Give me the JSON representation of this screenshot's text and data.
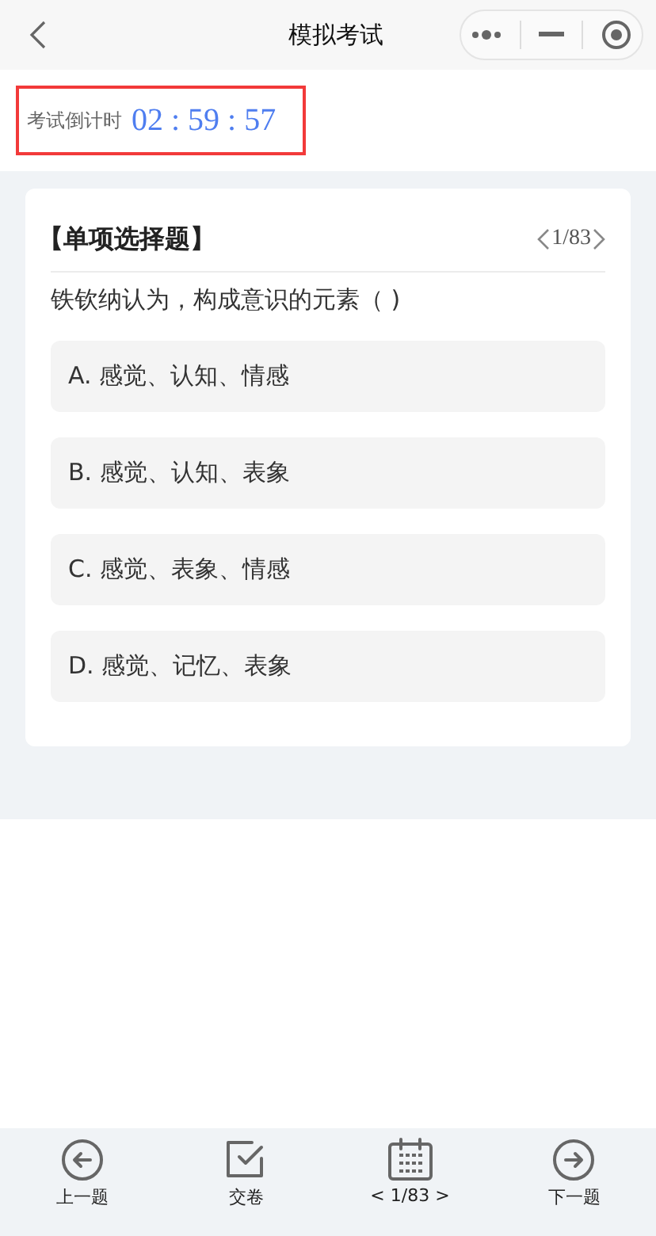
{
  "nav": {
    "title": "模拟考试"
  },
  "timer": {
    "label": "考试倒计时",
    "time": "02 : 59 : 57"
  },
  "question": {
    "type": "【单项选择题】",
    "counter": "1/83",
    "text": "铁钦纳认为，构成意识的元素（ )",
    "options": [
      {
        "text": "A. 感觉、认知、情感"
      },
      {
        "text": "B. 感觉、认知、表象"
      },
      {
        "text": "C. 感觉、表象、情感"
      },
      {
        "text": "D. 感觉、记忆、表象"
      }
    ]
  },
  "bottom_bar": [
    {
      "kind": "prev",
      "label": "上一题"
    },
    {
      "kind": "submit",
      "label": "交卷"
    },
    {
      "kind": "sheet",
      "label": "< 1/83 >"
    },
    {
      "kind": "next",
      "label": "下一题"
    }
  ]
}
